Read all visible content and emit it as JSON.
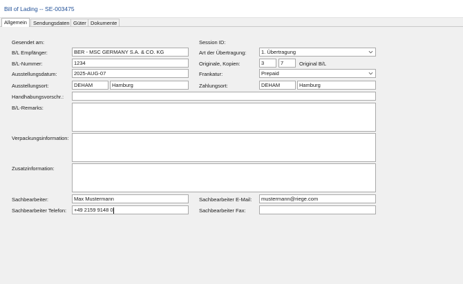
{
  "window": {
    "title": "Bill of Lading -- SE-003475"
  },
  "tabs": [
    {
      "label": "Allgemein"
    },
    {
      "label": "Sendungsdaten"
    },
    {
      "label": "Güter"
    },
    {
      "label": "Dokumente"
    }
  ],
  "form": {
    "gesendet_am_label": "Gesendet am:",
    "session_id_label": "Session ID:",
    "empfaenger_label": "B/L Empfänger:",
    "empfaenger_value": "BER - MSC GERMANY S.A. & CO. KG",
    "uebertragung_label": "Art der Übertragung:",
    "uebertragung_value": "1. Übertragung",
    "bl_nummer_label": "B/L-Nummer:",
    "bl_nummer_value": "1234",
    "originale_label": "Originale, Kopien:",
    "originale_value": "3",
    "kopien_value": "7",
    "original_bl_label": "Original B/L",
    "ausstellungsdatum_label": "Ausstellungsdatum:",
    "ausstellungsdatum_value": "2025-AUG-07",
    "frankatur_label": "Frankatur:",
    "frankatur_value": "Prepaid",
    "ausstellungsort_label": "Ausstellungsort:",
    "ausstellungsort_code": "DEHAM",
    "ausstellungsort_name": "Hamburg",
    "zahlungsort_label": "Zahlungsort:",
    "zahlungsort_code": "DEHAM",
    "zahlungsort_name": "Hamburg",
    "handhabung_label": "Handhabungsvorschr.:",
    "handhabung_value": "",
    "remarks_label": "B/L-Remarks:",
    "remarks_value": "",
    "verpackung_label": "Verpackungsinformation:",
    "verpackung_value": "",
    "zusatz_label": "Zusatzinformation:",
    "zusatz_value": "",
    "sachbearbeiter_label": "Sachbearbeiter:",
    "sachbearbeiter_value": "Max Mustermann",
    "email_label": "Sachbearbeiter E-Mail:",
    "email_value": "mustermann@riege.com",
    "telefon_label": "Sachbearbeiter Telefon:",
    "telefon_value": "+49 2159 9148 0",
    "fax_label": "Sachbearbeiter Fax:",
    "fax_value": ""
  },
  "icons": {
    "dropdown": "chevron-down-icon"
  }
}
